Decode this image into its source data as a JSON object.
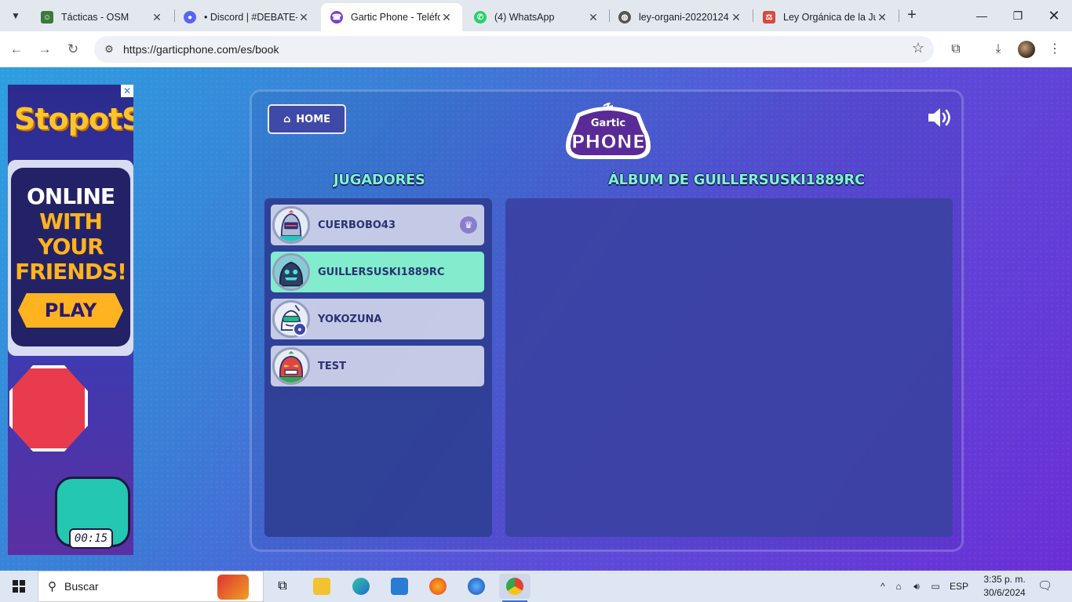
{
  "browser": {
    "tabs": [
      {
        "title": "Tácticas - OSM",
        "favicon_color": "#3a7a3a",
        "active": false
      },
      {
        "title": "• Discord | #DEBATE-PR",
        "favicon_color": "#5865f2",
        "active": false
      },
      {
        "title": "Gartic Phone - Teléfo",
        "favicon_color": "#7a3fd0",
        "active": true
      },
      {
        "title": "(4) WhatsApp",
        "favicon_color": "#25d366",
        "active": false
      },
      {
        "title": "ley-organi-20220124",
        "favicon_color": "#555555",
        "active": false
      },
      {
        "title": "Ley Orgánica de la Ju",
        "favicon_color": "#d84a3a",
        "active": false
      }
    ],
    "url": "https://garticphone.com/es/book"
  },
  "ad": {
    "logo_text": "StopotS",
    "line1": "ONLINE",
    "line2": "WITH",
    "line3": "YOUR",
    "line4": "FRIENDS!",
    "play_label": "PLAY",
    "timer": "00:15",
    "colors": {
      "logo": "#ffc42b",
      "play": "#ffb320"
    }
  },
  "game": {
    "home_label": "HOME",
    "logo_top": "Gartic",
    "logo_bottom": "PHONE",
    "players_title": "JUGADORES",
    "album_title": "ÁLBUM DE GUILLERSUSKI1889RC",
    "players": [
      {
        "name": "CUERBOBO43",
        "is_host": true,
        "is_me": false,
        "avatar": "knight-avatar"
      },
      {
        "name": "GUILLERSUSKI1889RC",
        "is_host": false,
        "is_me": true,
        "avatar": "dark-monster-avatar"
      },
      {
        "name": "YOKOZUNA",
        "is_host": false,
        "is_me": false,
        "avatar": "green-robot-avatar"
      },
      {
        "name": "TEST",
        "is_host": false,
        "is_me": false,
        "avatar": "red-mask-avatar"
      }
    ],
    "colors": {
      "title": "#7ff5cf",
      "me_highlight": "#86f4cd",
      "player_bg": "#ccd0e8"
    }
  },
  "taskbar": {
    "search_label": "Buscar",
    "language": "ESP",
    "time": "3:35 p. m.",
    "date": "30/6/2024"
  }
}
